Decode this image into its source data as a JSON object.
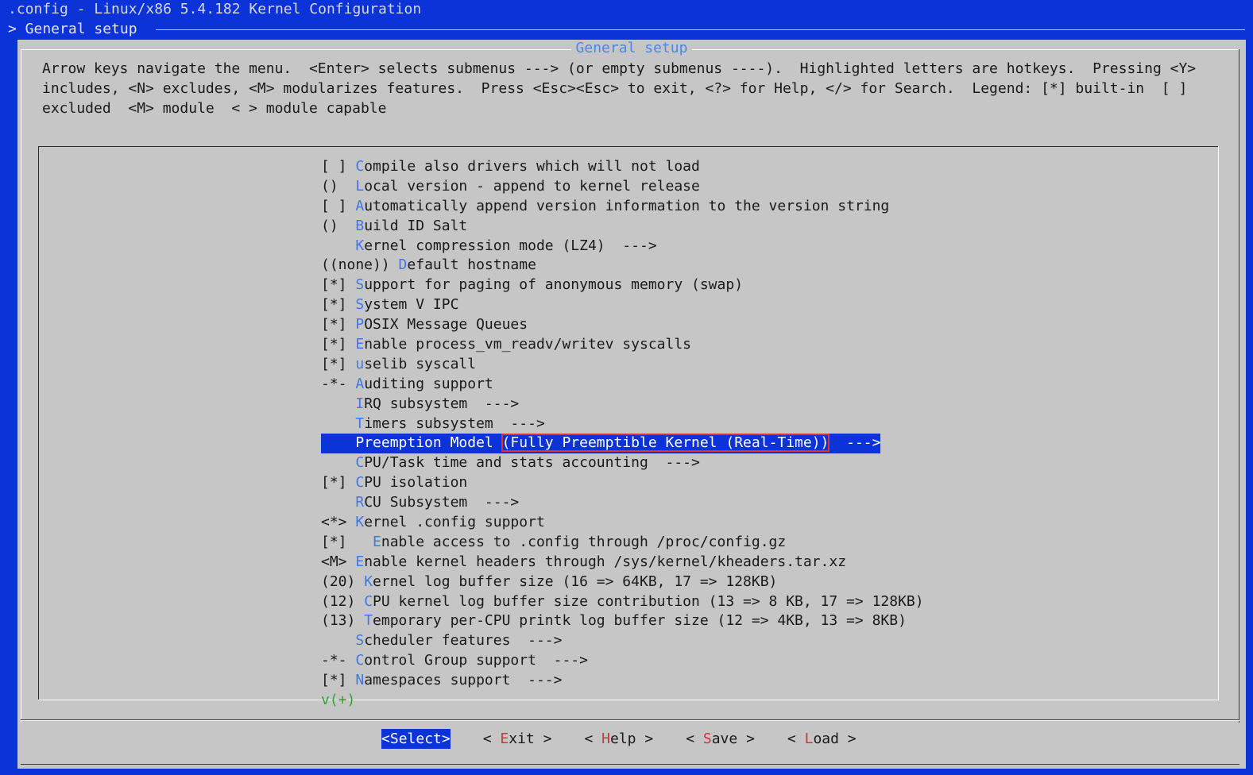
{
  "window": {
    "title": ".config - Linux/x86 5.4.182 Kernel Configuration",
    "breadcrumb": "> General setup"
  },
  "dialog": {
    "title": "General setup",
    "help_lines": [
      "Arrow keys navigate the menu.  <Enter> selects submenus ---> (or empty submenus ----).  Highlighted letters are hotkeys.  Pressing <Y>",
      "includes, <N> excludes, <M> modularizes features.  Press <Esc><Esc> to exit, <?> for Help, </> for Search.  Legend: [*] built-in  [ ]",
      "excluded  <M> module  < > module capable"
    ]
  },
  "menu": {
    "items": [
      {
        "prefix": "[ ] ",
        "hotkey": "C",
        "rest": "ompile also drivers which will not load"
      },
      {
        "prefix": "()  ",
        "hotkey": "L",
        "rest": "ocal version - append to kernel release"
      },
      {
        "prefix": "[ ] ",
        "hotkey": "A",
        "rest": "utomatically append version information to the version string"
      },
      {
        "prefix": "()  ",
        "hotkey": "B",
        "rest": "uild ID Salt"
      },
      {
        "prefix": "    ",
        "hotkey": "K",
        "rest": "ernel compression mode (LZ4)  --->"
      },
      {
        "prefix": "((none)) ",
        "hotkey": "D",
        "rest": "efault hostname"
      },
      {
        "prefix": "[*] ",
        "hotkey": "S",
        "rest": "upport for paging of anonymous memory (swap)"
      },
      {
        "prefix": "[*] ",
        "hotkey": "S",
        "rest": "ystem V IPC"
      },
      {
        "prefix": "[*] ",
        "hotkey": "P",
        "rest": "OSIX Message Queues"
      },
      {
        "prefix": "[*] ",
        "hotkey": "E",
        "rest": "nable process_vm_readv/writev syscalls"
      },
      {
        "prefix": "[*] ",
        "hotkey": "u",
        "rest": "selib syscall"
      },
      {
        "prefix": "-*- ",
        "hotkey": "A",
        "rest": "uditing support"
      },
      {
        "prefix": "    ",
        "hotkey": "I",
        "rest": "RQ subsystem  --->"
      },
      {
        "prefix": "    ",
        "hotkey": "T",
        "rest": "imers subsystem  --->"
      },
      {
        "prefix": "    ",
        "hotkey": "C",
        "rest": "PU/Task time and stats accounting  --->"
      },
      {
        "prefix": "[*] ",
        "hotkey": "C",
        "rest": "PU isolation"
      },
      {
        "prefix": "    ",
        "hotkey": "R",
        "rest": "CU Subsystem  --->"
      },
      {
        "prefix": "<*> ",
        "hotkey": "K",
        "rest": "ernel .config support"
      },
      {
        "prefix": "[*]   ",
        "hotkey": "E",
        "rest": "nable access to .config through /proc/config.gz"
      },
      {
        "prefix": "<M> ",
        "hotkey": "E",
        "rest": "nable kernel headers through /sys/kernel/kheaders.tar.xz"
      },
      {
        "prefix": "(20) ",
        "hotkey": "K",
        "rest": "ernel log buffer size (16 => 64KB, 17 => 128KB)"
      },
      {
        "prefix": "(12) ",
        "hotkey": "C",
        "rest": "PU kernel log buffer size contribution (13 => 8 KB, 17 => 128KB)"
      },
      {
        "prefix": "(13) ",
        "hotkey": "T",
        "rest": "emporary per-CPU printk log buffer size (12 => 4KB, 13 => 8KB)"
      },
      {
        "prefix": "    ",
        "hotkey": "S",
        "rest": "cheduler features  --->"
      },
      {
        "prefix": "-*- ",
        "hotkey": "C",
        "rest": "ontrol Group support  --->"
      },
      {
        "prefix": "[*] ",
        "hotkey": "N",
        "rest": "amespaces support  --->"
      }
    ],
    "selected": {
      "prefix": "    ",
      "label": "Preemption Model ",
      "value": "(Fully Preemptible Kernel (Real-Time))",
      "suffix": "  --->"
    },
    "more_indicator": "v(+)"
  },
  "buttons": [
    {
      "open": "<",
      "hotkey": "S",
      "rest": "elect",
      "close": ">",
      "active": true
    },
    {
      "open": "< ",
      "hotkey": "E",
      "rest": "xit",
      "close": " >",
      "active": false
    },
    {
      "open": "< ",
      "hotkey": "H",
      "rest": "elp",
      "close": " >",
      "active": false
    },
    {
      "open": "< ",
      "hotkey": "S",
      "rest": "ave",
      "close": " >",
      "active": false
    },
    {
      "open": "< ",
      "hotkey": "L",
      "rest": "oad",
      "close": " >",
      "active": false
    }
  ],
  "colors": {
    "background": "#0b33d8",
    "dialog": "#c6c6c6",
    "hotkey": "#3f78e8",
    "button_hotkey": "#d8303a",
    "highlight_outline": "#e0322a",
    "more_indicator": "#2ba82b"
  }
}
